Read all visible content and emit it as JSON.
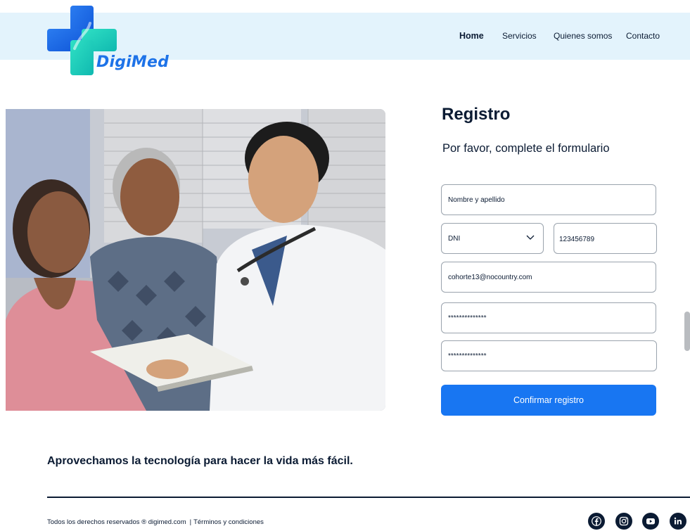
{
  "brand": {
    "name": "DigiMed",
    "accent": "#1876f2",
    "dark": "#0b1b33",
    "header_bg": "#e3f3fc"
  },
  "nav": {
    "items": [
      {
        "label": "Home",
        "active": true
      },
      {
        "label": "Servicios"
      },
      {
        "label": "Quienes somos"
      },
      {
        "label": "Contacto"
      }
    ]
  },
  "form": {
    "title": "Registro",
    "subtitle": "Por favor, complete el formulario",
    "name_field": "Nombre y apellido",
    "doc_type": "DNI",
    "doc_number": "123456789",
    "email": "cohorte13@nocountry.com",
    "password": "**************",
    "password_confirm": "**************",
    "submit_label": "Confirmar registro"
  },
  "tagline": "Aprovechamos la tecnología para hacer la vida más fácil.",
  "footer": {
    "copyright": "Todos los derechos reservados ® digimed.com",
    "separator": "|",
    "terms": "Términos y condiciones",
    "social_icons": [
      "facebook-icon",
      "instagram-icon",
      "youtube-icon",
      "linkedin-icon"
    ]
  }
}
